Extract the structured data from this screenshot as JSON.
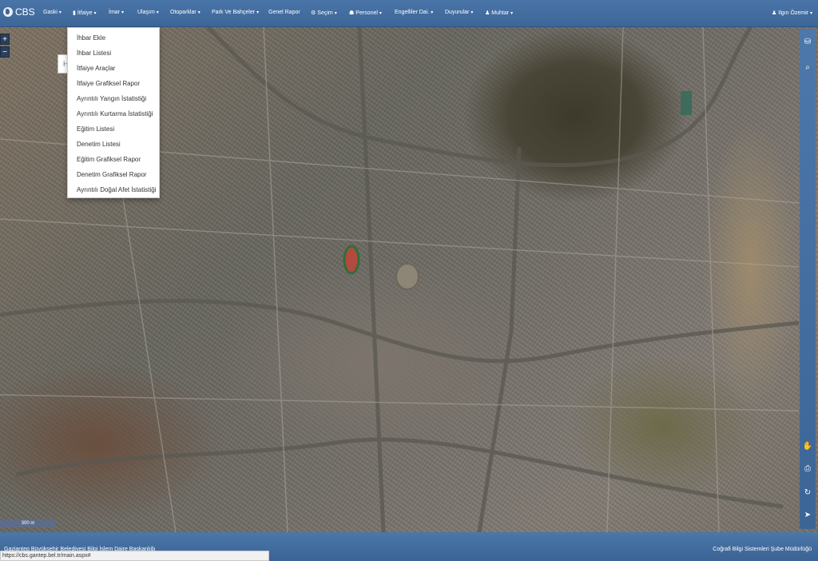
{
  "header": {
    "brand": "CBS",
    "user": "Ilgın Özemir",
    "nav": [
      {
        "label": "Gaski",
        "icon": null
      },
      {
        "label": "İtfaiye",
        "icon": "fire-icon"
      },
      {
        "label": "İmar",
        "icon": null
      },
      {
        "label": "Ulaşım",
        "icon": null
      },
      {
        "label": "Otoparklar",
        "icon": null
      },
      {
        "label": "Park Ve Bahçeler",
        "icon": null
      },
      {
        "label": "Genel Rapor",
        "icon": null
      },
      {
        "label": "Seçim",
        "icon": "gear-icon"
      },
      {
        "label": "Personel",
        "icon": "users-icon"
      },
      {
        "label": "Engelliler Dai.",
        "icon": null
      },
      {
        "label": "Duyurular",
        "icon": null
      },
      {
        "label": "Muhtar",
        "icon": "user-icon"
      }
    ]
  },
  "itfaiye_menu": [
    "İhbar Ekle",
    "İhbar Listesi",
    "İtfaiye Araçlar",
    "İtfaiye Grafiksel Rapor",
    "Ayrıntılı Yangın İstatistiği",
    "Ayrıntılı Kurtarma İstatistiği",
    "Eğitim Listesi",
    "Denetim Listesi",
    "Eğitim Grafiksel Rapor",
    "Denetim Grafiksel Rapor",
    "Ayrıntılı Doğal Afet İstatistiği"
  ],
  "map": {
    "zoom_in": "+",
    "zoom_out": "−",
    "scale": "300 m",
    "search_stub": "H"
  },
  "toolbar_right": [
    "layers-icon",
    "search-icon",
    "hand-icon",
    "print-icon",
    "refresh-icon",
    "locate-icon"
  ],
  "footer": {
    "left": "Gaziantep Büyükşehir Belediyesi Bilgi İşlem Daire Başkanlığı",
    "right": "Coğrafi Bilgi Sistemleri Şube Müdürlüğü"
  },
  "status_url": "https://cbs.gantep.bel.tr/main.aspx#"
}
